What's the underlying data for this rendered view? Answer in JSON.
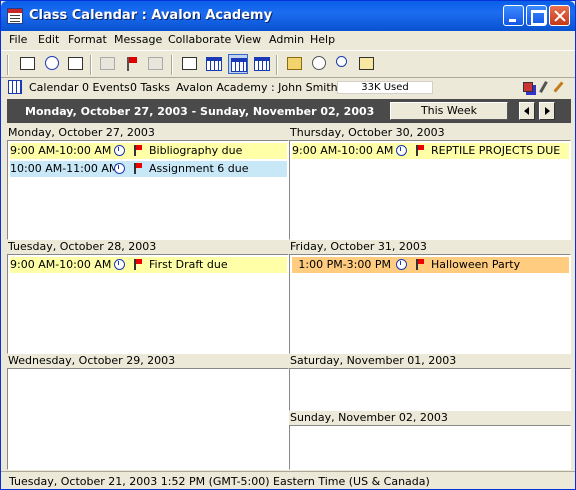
{
  "window": {
    "title": "Class Calendar : Avalon Academy"
  },
  "menu": [
    "File",
    "Edit",
    "Format",
    "Message",
    "Collaborate",
    "View",
    "Admin",
    "Help"
  ],
  "info": {
    "section": "Calendar",
    "events": "0 Events",
    "tasks": "0 Tasks",
    "user": "Avalon Academy : John Smith",
    "storage": "33K Used"
  },
  "range": {
    "label": "Monday, October 27, 2003 - Sunday, November 02, 2003",
    "this_week": "This Week"
  },
  "days": [
    {
      "label": "Monday, October 27, 2003",
      "events": [
        {
          "time": "9:00 AM-10:00 AM",
          "title": "Bibliography due",
          "color": "#ffffa8",
          "flag": true
        },
        {
          "time": "10:00 AM-11:00 AM",
          "title": "Assignment 6 due",
          "color": "#c8e8f8",
          "flag": true
        }
      ]
    },
    {
      "label": "Tuesday, October 28, 2003",
      "events": [
        {
          "time": "9:00 AM-10:00 AM",
          "title": "First Draft due",
          "color": "#ffffa8",
          "flag": true
        }
      ]
    },
    {
      "label": "Wednesday, October 29, 2003",
      "events": []
    },
    {
      "label": "Thursday, October 30, 2003",
      "events": [
        {
          "time": "9:00 AM-10:00 AM",
          "title": "REPTILE PROJECTS DUE",
          "color": "#ffffa8",
          "flag": true
        }
      ]
    },
    {
      "label": "Friday, October 31, 2003",
      "events": [
        {
          "time": "1:00 PM-3:00 PM",
          "title": "Halloween Party",
          "color": "#ffcc80",
          "flag": true
        }
      ]
    },
    {
      "label": "Saturday, November 01, 2003",
      "events": []
    },
    {
      "label": "Sunday, November 02, 2003",
      "events": []
    }
  ],
  "icons": {
    "toolbar": [
      "new-event-icon",
      "new-appointment-icon",
      "new-task-icon",
      "print-icon",
      "flag-icon",
      "delete-icon",
      "list-view-icon",
      "month-view-icon",
      "week-view-icon",
      "day-view-icon",
      "folder-icon",
      "find-icon",
      "search-icon",
      "print-preview-icon"
    ],
    "info": [
      "calendar-icon",
      "layers-icon",
      "pencil-icon",
      "brush-icon"
    ]
  },
  "status": {
    "text": "Tuesday, October 21, 2003 1:52 PM (GMT-5:00) Eastern Time (US & Canada)"
  }
}
